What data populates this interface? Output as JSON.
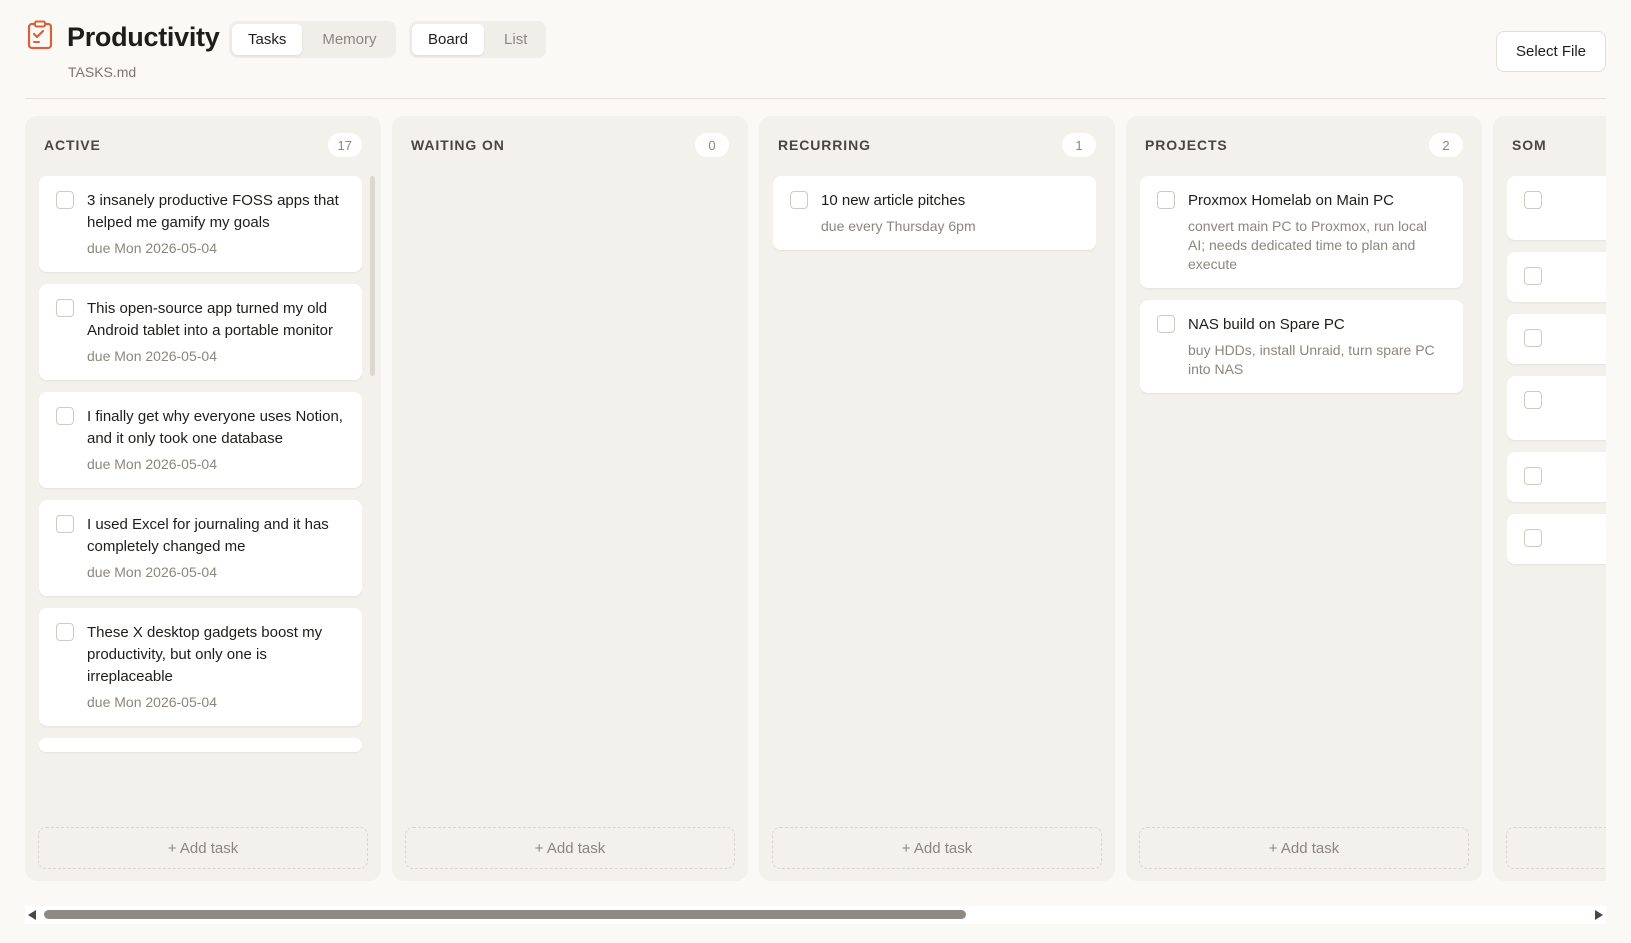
{
  "app": {
    "title": "Productivity",
    "file": "TASKS.md",
    "accent_color": "#d9603b",
    "icon": "clipboard-check-icon"
  },
  "view_tabs": [
    {
      "label": "Tasks",
      "active": true
    },
    {
      "label": "Memory",
      "active": false
    }
  ],
  "mode_tabs": [
    {
      "label": "Board",
      "active": true
    },
    {
      "label": "List",
      "active": false
    }
  ],
  "select_file_label": "Select File",
  "add_task_label": "+ Add task",
  "columns": [
    {
      "title": "ACTIVE",
      "count": "17",
      "cards": [
        {
          "title": "3 insanely productive FOSS apps that helped me gamify my goals",
          "meta": "due Mon 2026-05-04"
        },
        {
          "title": "This open-source app turned my old Android tablet into a portable monitor",
          "meta": "due Mon 2026-05-04"
        },
        {
          "title": "I finally get why everyone uses Notion, and it only took one database",
          "meta": "due Mon 2026-05-04"
        },
        {
          "title": "I used Excel for journaling and it has completely changed me",
          "meta": "due Mon 2026-05-04"
        },
        {
          "title": "These X desktop gadgets boost my productivity, but only one is irreplaceable",
          "meta": "due Mon 2026-05-04"
        }
      ]
    },
    {
      "title": "WAITING ON",
      "count": "0",
      "cards": []
    },
    {
      "title": "RECURRING",
      "count": "1",
      "cards": [
        {
          "title": "10 new article pitches",
          "meta": "due every Thursday 6pm"
        }
      ]
    },
    {
      "title": "PROJECTS",
      "count": "2",
      "cards": [
        {
          "title": "Proxmox Homelab on Main PC",
          "meta": "convert main PC to Proxmox, run local AI; needs dedicated time to plan and execute"
        },
        {
          "title": "NAS build on Spare PC",
          "meta": "buy HDDs, install Unraid, turn spare PC into NAS"
        }
      ]
    },
    {
      "title": "SOM",
      "count": "",
      "cards": []
    }
  ]
}
